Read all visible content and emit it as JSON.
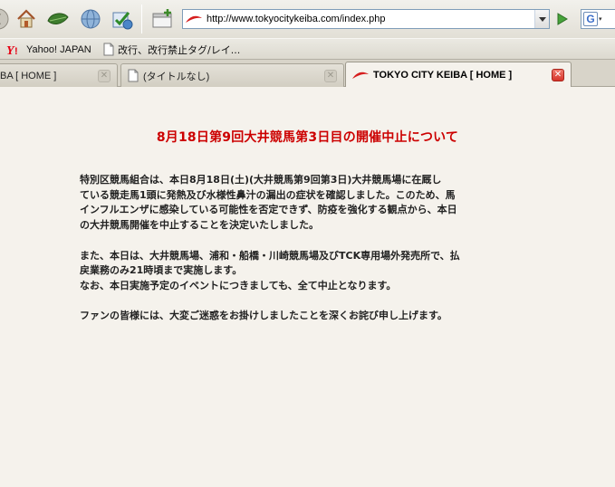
{
  "toolbar": {
    "icons": [
      "back-icon",
      "home-icon",
      "leaf-icon",
      "globe-icon",
      "bookmark-check-icon",
      "new-tab-icon"
    ],
    "url": "http://www.tokyocitykeiba.com/index.php",
    "search_engine": "G"
  },
  "bookmarks": [
    {
      "label": "Yahoo! JAPAN",
      "icon": "yahoo-icon"
    },
    {
      "label": "改行、改行禁止タグ/レイ...",
      "icon": "page-icon"
    }
  ],
  "tabs": [
    {
      "title": "BA [ HOME ]",
      "active": false
    },
    {
      "title": "(タイトルなし)",
      "active": false
    },
    {
      "title": "TOKYO CITY KEIBA [ HOME ]",
      "active": true
    }
  ],
  "page": {
    "heading": "8月18日第9回大井競馬第3日目の開催中止について",
    "paragraphs": [
      [
        "特別区競馬組合は、本日8月18日(土)(大井競馬第9回第3日)大井競馬場に在厩し",
        "ている競走馬1頭に発熱及び水様性鼻汁の漏出の症状を確認しました。このため、馬",
        "インフルエンザに感染している可能性を否定できず、防疫を強化する観点から、本日",
        "の大井競馬開催を中止することを決定いたしました。"
      ],
      [
        "また、本日は、大井競馬場、浦和・船橋・川崎競馬場及びTCK専用場外発売所で、払",
        "戻業務のみ21時頃まで実施します。",
        "なお、本日実施予定のイベントにつきましても、全て中止となります。"
      ],
      [
        "ファンの皆様には、大変ご迷惑をお掛けしましたことを深くお詫び申し上げます。"
      ]
    ]
  },
  "colors": {
    "heading": "#cc0000",
    "body_text": "#222222",
    "page_background": "#f5f2ec"
  }
}
